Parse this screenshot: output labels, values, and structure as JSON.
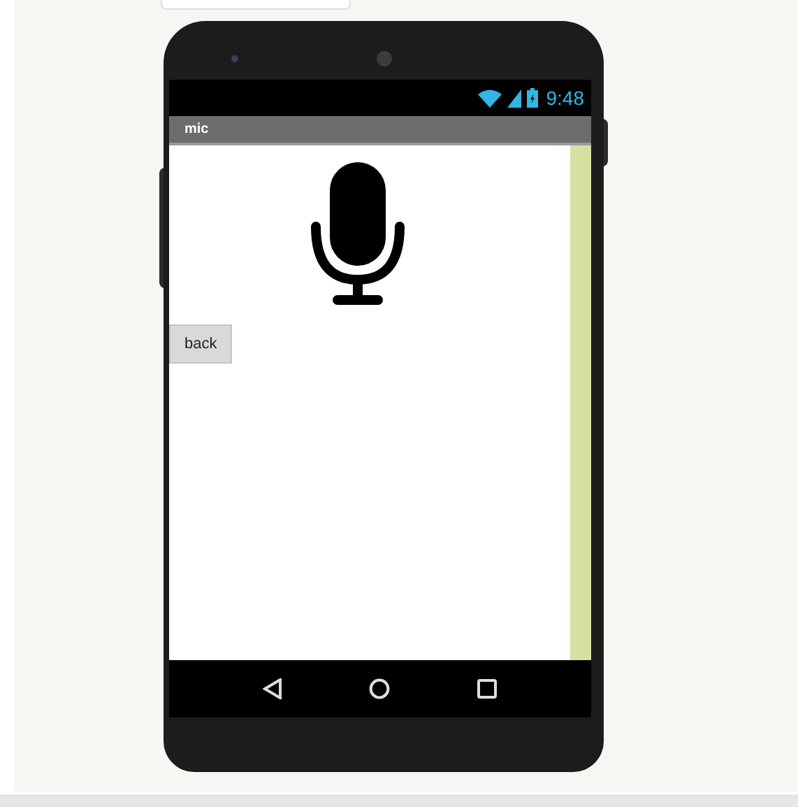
{
  "status_bar": {
    "time": "9:48"
  },
  "title_bar": {
    "title": "mic"
  },
  "buttons": [
    {
      "label": "back"
    }
  ]
}
